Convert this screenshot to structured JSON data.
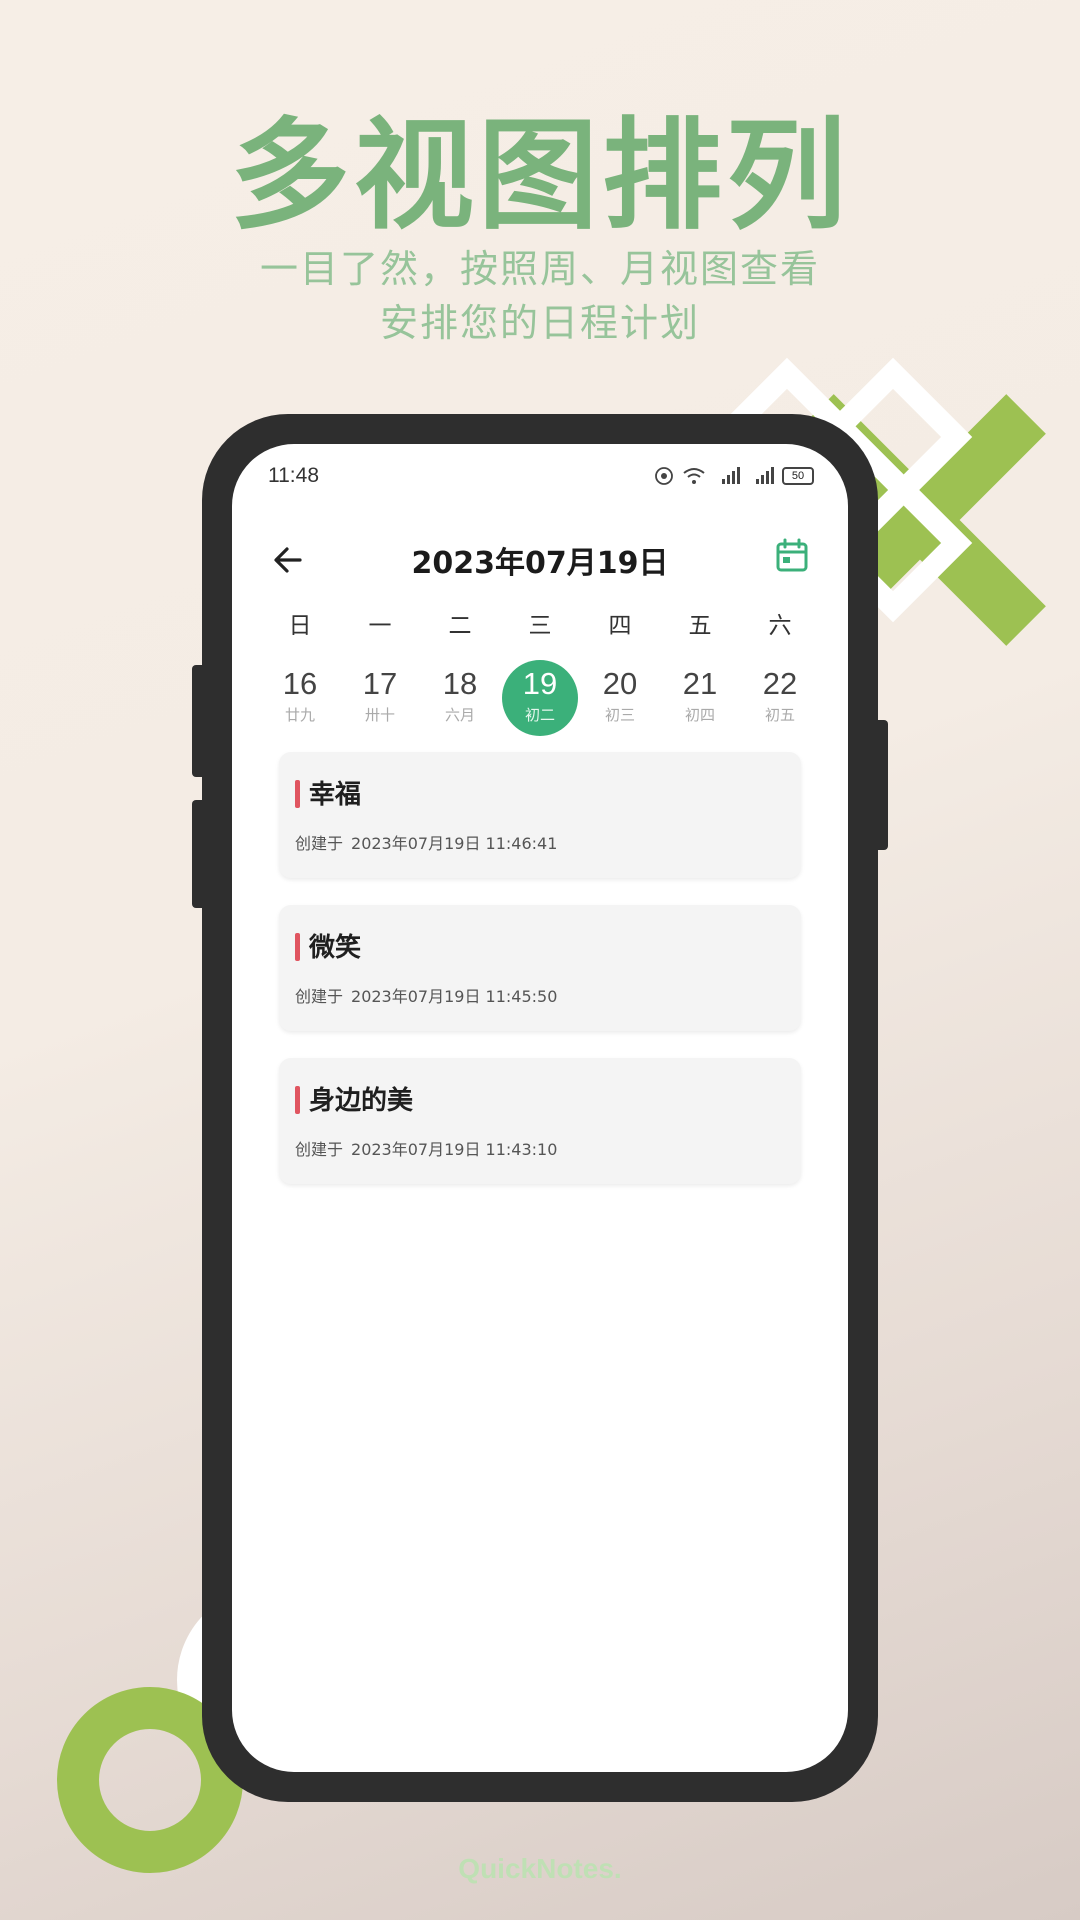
{
  "hero": {
    "title": "多视图排列",
    "subtitle_line1": "一目了然，按照周、月视图查看",
    "subtitle_line2": "安排您的日程计划"
  },
  "brand": "QuickNotes.",
  "colors": {
    "accent_green": "#3bb07a",
    "hero_green": "#7ab37c",
    "deco_green": "#9dc152",
    "marker_red": "#e05560"
  },
  "status_bar": {
    "time": "11:48",
    "battery": "50",
    "icons": [
      "hd-icon",
      "wifi-icon",
      "signal-5g-icon",
      "signal-4g-icon",
      "battery-icon"
    ]
  },
  "nav": {
    "title": "2023年07月19日",
    "back_icon": "arrow-left-icon",
    "calendar_icon": "calendar-icon"
  },
  "week": {
    "labels": [
      "日",
      "一",
      "二",
      "三",
      "四",
      "五",
      "六"
    ],
    "days": [
      {
        "num": "16",
        "lunar": "廿九",
        "selected": false
      },
      {
        "num": "17",
        "lunar": "卅十",
        "selected": false
      },
      {
        "num": "18",
        "lunar": "六月",
        "selected": false
      },
      {
        "num": "19",
        "lunar": "初二",
        "selected": true
      },
      {
        "num": "20",
        "lunar": "初三",
        "selected": false
      },
      {
        "num": "21",
        "lunar": "初四",
        "selected": false
      },
      {
        "num": "22",
        "lunar": "初五",
        "selected": false
      }
    ]
  },
  "notes": [
    {
      "title": "幸福",
      "created_label": "创建于",
      "created_at": "2023年07月19日 11:46:41"
    },
    {
      "title": "微笑",
      "created_label": "创建于",
      "created_at": "2023年07月19日 11:45:50"
    },
    {
      "title": "身边的美",
      "created_label": "创建于",
      "created_at": "2023年07月19日 11:43:10"
    }
  ]
}
